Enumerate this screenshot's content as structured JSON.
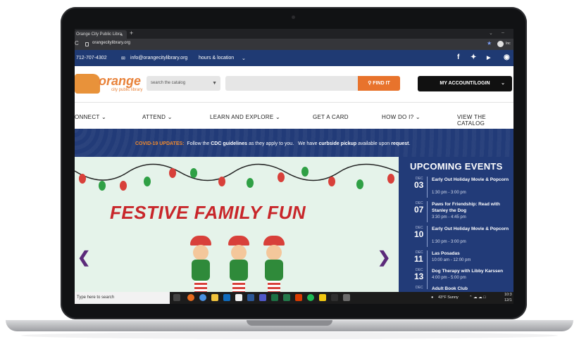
{
  "browser": {
    "tab_title": "Orange City Public Libra",
    "tab_close": "×",
    "new_tab": "+",
    "url": "orangecitylibrary.org",
    "profile_label": "Inc"
  },
  "topbar": {
    "phone": "712-707-4302",
    "email": "info@orangecitylibrary.org",
    "hours": "hours & location"
  },
  "header": {
    "logo_text": "orange",
    "logo_sub": "city public library",
    "search_select": "search the catalog",
    "find_button": "FIND IT",
    "account_button": "MY ACCOUNT/LOGIN"
  },
  "nav": {
    "connect": "ONNECT",
    "attend": "ATTEND",
    "learn": "LEARN AND EXPLORE",
    "card": "GET A CARD",
    "howdoi": "HOW DO I?",
    "catalog": "VIEW THE CATALOG"
  },
  "covid": {
    "title": "COVID-19 UPDATES:",
    "text1": "Follow the",
    "cdc": "CDC guidelines",
    "text2": "as they apply to you.",
    "text3": "We have",
    "pickup": "curbside pickup",
    "text4": "available upon",
    "request": "request",
    "dot": "."
  },
  "hero": {
    "title": "FESTIVE FAMILY FUN"
  },
  "events": {
    "title": "UPCOMING EVENTS",
    "items": [
      {
        "month": "DEC",
        "day": "03",
        "name": "Early Out Holiday Movie & Popcorn",
        "time": "1:30 pm - 3:00 pm"
      },
      {
        "month": "DEC",
        "day": "07",
        "name": "Paws for Friendship: Read with Stanley the Dog",
        "time": "3:30 pm - 4:45 pm"
      },
      {
        "month": "DEC",
        "day": "10",
        "name": "Early Out Holiday Movie & Popcorn",
        "time": "1:30 pm - 3:00 pm"
      },
      {
        "month": "DEC",
        "day": "11",
        "name": "Las Posadas",
        "time": "10:00 am - 12:00 pm"
      },
      {
        "month": "DEC",
        "day": "13",
        "name": "Dog Therapy with Libby Karssen",
        "time": "4:00 pm - 5:00 pm"
      },
      {
        "month": "DEC",
        "day": "",
        "name": "Adult Book Club",
        "time": ""
      }
    ]
  },
  "taskbar": {
    "search_placeholder": "Type here to search",
    "weather": "43°F  Sunny",
    "time": "10:3",
    "date": "12/1"
  },
  "colors": {
    "brand_blue": "#1f3a73",
    "brand_orange": "#e8732c",
    "hero_red": "#c8262a"
  }
}
